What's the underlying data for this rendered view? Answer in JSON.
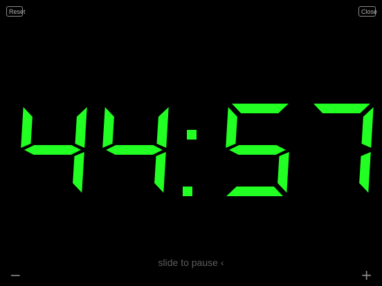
{
  "toolbar": {
    "reset_label": "Reset",
    "close_label": "Close"
  },
  "timer": {
    "minutes": "44",
    "seconds": "57",
    "display": "44:57",
    "color": "#22ff22"
  },
  "footer": {
    "slide_label": "slide to pause ‹",
    "minus_label": "−",
    "plus_label": "+"
  }
}
